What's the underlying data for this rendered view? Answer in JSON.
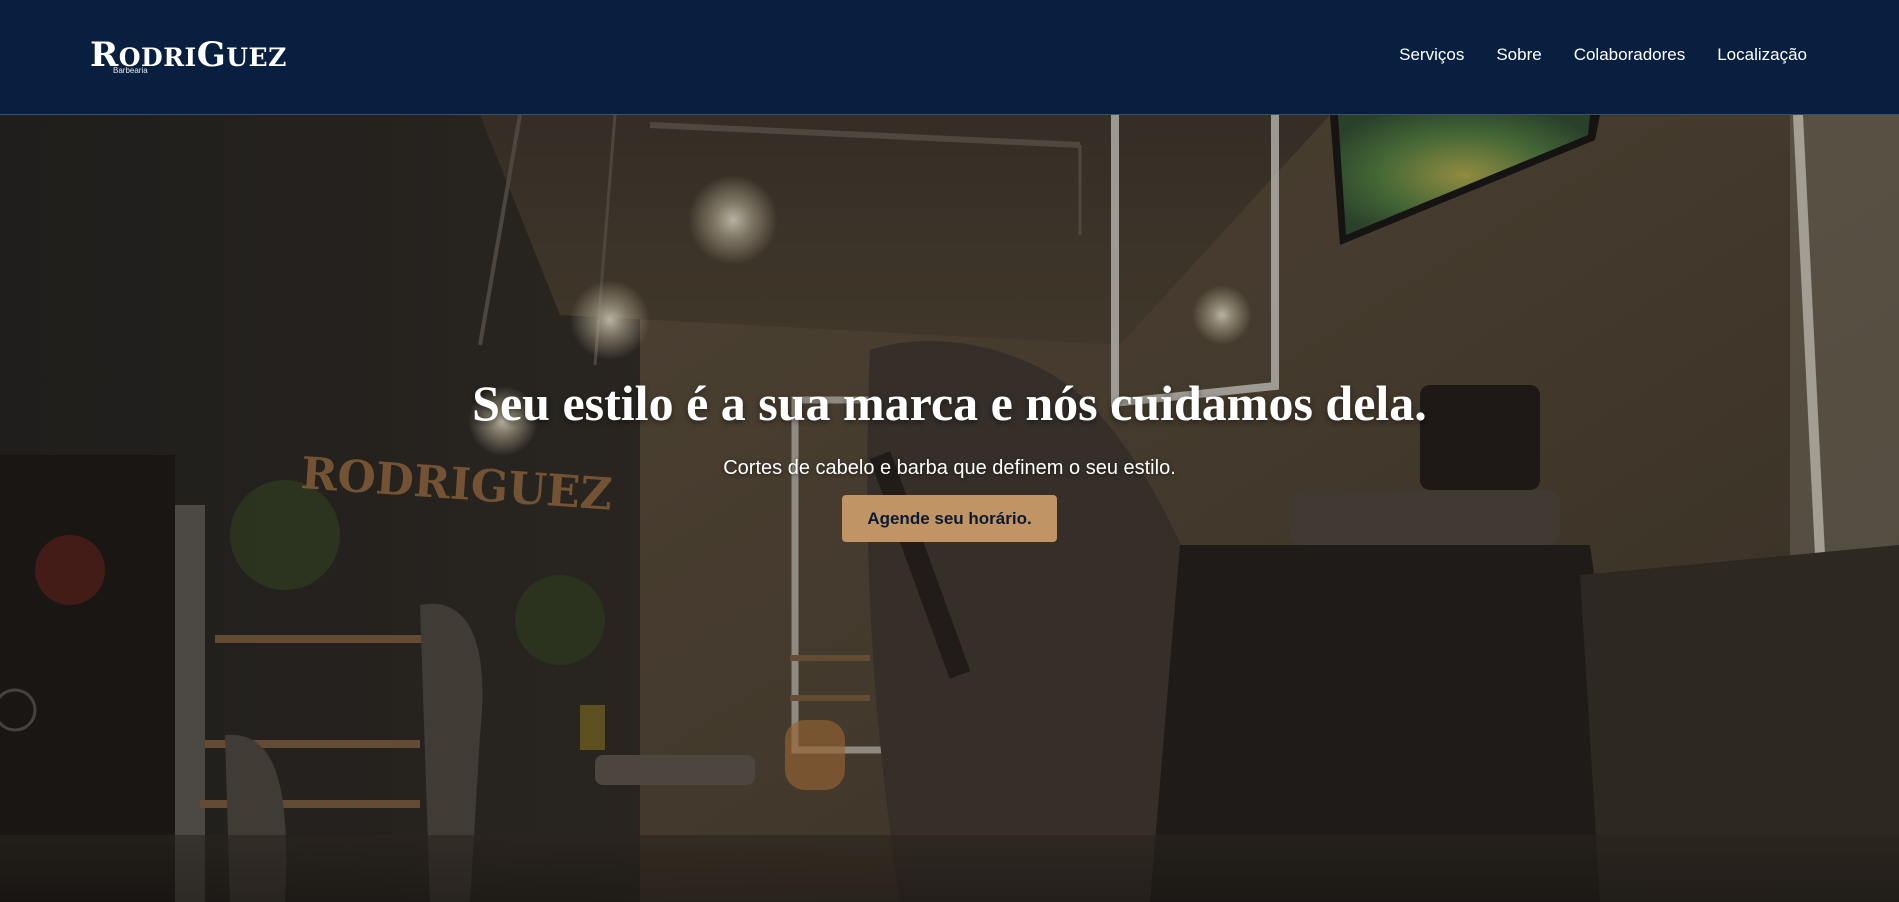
{
  "brand": {
    "logo_initial": "R",
    "logo_first": "ODRI",
    "logo_g": "G",
    "logo_rest": "UEZ",
    "logo_subtitle": "Barbearia"
  },
  "nav": {
    "items": [
      {
        "label": "Serviços"
      },
      {
        "label": "Sobre"
      },
      {
        "label": "Colaboradores"
      },
      {
        "label": "Localização"
      }
    ]
  },
  "hero": {
    "title": "Seu estilo é a sua marca e nós cuidamos dela.",
    "subtitle": "Cortes de cabelo e barba que definem o seu estilo.",
    "cta_label": "Agende seu horário.",
    "wall_sign_word": "RODRIGUEZ"
  },
  "colors": {
    "header_bg": "#081f40",
    "accent": "#c09464",
    "text": "#ffffff"
  }
}
